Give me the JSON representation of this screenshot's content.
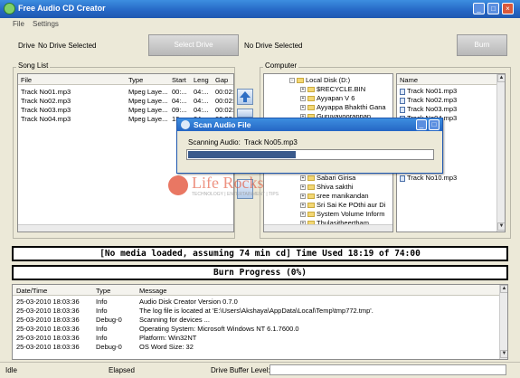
{
  "window": {
    "title": "Free Audio CD Creator"
  },
  "menu": [
    "File",
    "Settings"
  ],
  "drive": {
    "label": "Drive",
    "value": "No Drive Selected",
    "select_button": "Select Drive",
    "right_value": "No Drive Selected",
    "burn_button": "Burn"
  },
  "song_list": {
    "group_label": "Song List",
    "columns": [
      "File",
      "Type",
      "Start",
      "Leng",
      "Gap"
    ],
    "rows": [
      [
        "Track No01.mp3",
        "Mpeg Laye...",
        "00:...",
        "04:...",
        "00:02:0"
      ],
      [
        "Track No02.mp3",
        "Mpeg Laye...",
        "04:...",
        "04:...",
        "00:02:0"
      ],
      [
        "Track No03.mp3",
        "Mpeg Laye...",
        "09:...",
        "04:...",
        "00:02:0"
      ],
      [
        "Track No04.mp3",
        "Mpeg Laye...",
        "13:...",
        "04:...",
        "00:02:0"
      ]
    ]
  },
  "computer": {
    "group_label": "Computer",
    "tree": [
      "Local Disk (D:)",
      "$RECYCLE.BIN",
      "Ayyapan V 6",
      "Ayyappa Bhakthi Gana",
      "Guruvayoorappan"
    ],
    "tree_lower": [
      "Sabari Girisa",
      "Shiva sakthi",
      "sree manikandan",
      "Sri Sai Ke POthi aur Di",
      "System Volume Inform",
      "Thulasitheertham"
    ],
    "name_header": "Name",
    "files": [
      "Track No01.mp3",
      "Track No02.mp3",
      "Track No03.mp3",
      "Track No04.mp3",
      "Track No10.mp3"
    ]
  },
  "dialog": {
    "title": "Scan Audio File",
    "label": "Scanning Audio:",
    "file": "Track No05.mp3",
    "progress": 0.44
  },
  "watermark": {
    "text": "Life Rocks",
    "sub": "TECHNOLOGY | ENTERTAINMENT | TIPS"
  },
  "banner_time": "[No media loaded, assuming 74 min cd] Time Used 18:19 of 74:00",
  "banner_burn": "Burn Progress (0%)",
  "log": {
    "columns": [
      "Date/Time",
      "Type",
      "Message"
    ],
    "rows": [
      [
        "25-03-2010 18:03:36",
        "Info",
        "Audio Disk Creator Version 0.7.0"
      ],
      [
        "25-03-2010 18:03:36",
        "Info",
        "The log file is located at 'E:\\Users\\Akshaya\\AppData\\Local\\Temp\\tmp772.tmp'."
      ],
      [
        "25-03-2010 18:03:36",
        "Debug-0",
        "Scanning for devices ..."
      ],
      [
        "25-03-2010 18:03:36",
        "Info",
        "Operating System: Microsoft Windows NT 6.1.7600.0"
      ],
      [
        "25-03-2010 18:03:36",
        "Info",
        "Platform: Win32NT"
      ],
      [
        "25-03-2010 18:03:36",
        "Debug-0",
        "OS Word Size: 32"
      ]
    ]
  },
  "status": {
    "state": "Idle",
    "elapsed": "Elapsed",
    "buffer": "Drive Buffer Level:"
  }
}
